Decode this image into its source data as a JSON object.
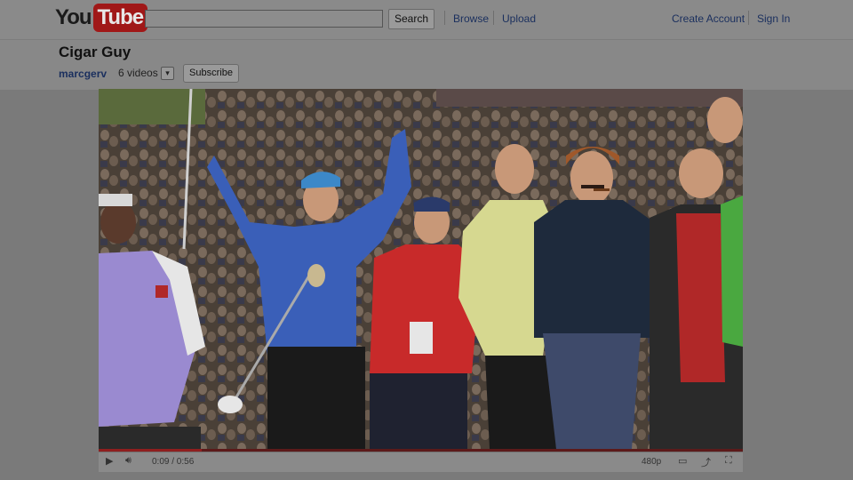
{
  "header": {
    "logo": {
      "you": "You",
      "tube": "Tube"
    },
    "search": {
      "value": "",
      "placeholder": "",
      "button_label": "Search"
    },
    "nav": {
      "browse": "Browse",
      "upload": "Upload"
    },
    "account": {
      "create": "Create Account",
      "sign_in": "Sign In"
    }
  },
  "video": {
    "title": "Cigar Guy",
    "uploader": "marcgerv",
    "video_count": "6 videos",
    "subscribe_label": "Subscribe"
  },
  "player": {
    "time": "0:09 / 0:56",
    "quality": "480p",
    "progress_fraction": 0.16
  },
  "colors": {
    "accent": "#8f1e1e",
    "link": "#1a2f5e",
    "overlay": "#7a7a7a"
  }
}
